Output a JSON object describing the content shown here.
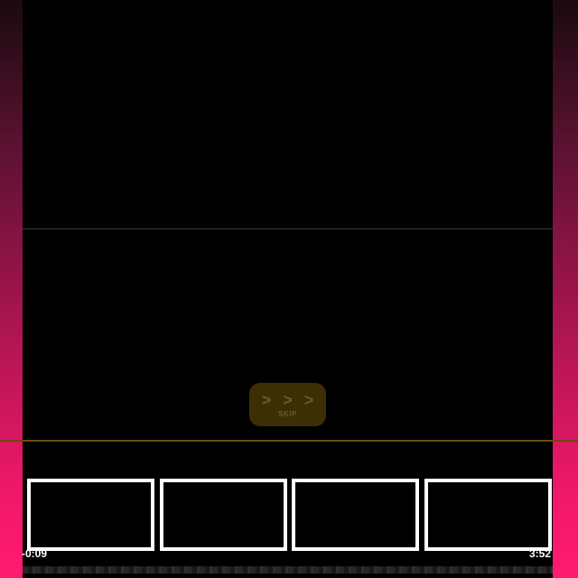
{
  "skip_button": {
    "arrows": "> > >",
    "label": "SKIP"
  },
  "timeline": {
    "elapsed": "-0:09",
    "duration": "3:52",
    "thumbnail_count": 4
  },
  "colors": {
    "side_accent": "#ff1a6e",
    "skip_bg": "#3c2f06",
    "divider_orange": "#6b4a10"
  }
}
